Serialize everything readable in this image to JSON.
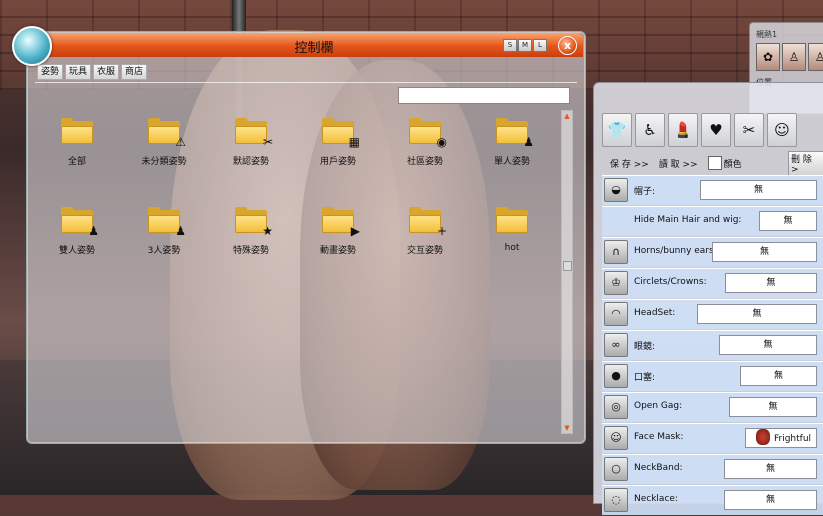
{
  "window": {
    "title": "控制欄",
    "size_buttons": [
      "S",
      "M",
      "L"
    ],
    "close_label": "x"
  },
  "menu": [
    "姿勢",
    "玩具",
    "衣服",
    "商店"
  ],
  "search": {
    "value": ""
  },
  "folders": [
    {
      "label": "全部",
      "icon": "multi-folder-icon",
      "badge": ""
    },
    {
      "label": "未分類姿勢",
      "icon": "warning-folder-icon",
      "badge": "⚠"
    },
    {
      "label": "默認姿勢",
      "icon": "pose-folder-icon",
      "badge": "✂"
    },
    {
      "label": "用戶姿勢",
      "icon": "user-folder-icon",
      "badge": "▦"
    },
    {
      "label": "社區姿勢",
      "icon": "community-folder-icon",
      "badge": "◉"
    },
    {
      "label": "單人姿勢",
      "icon": "single-folder-icon",
      "badge": "♟"
    },
    {
      "label": "雙人姿勢",
      "icon": "couple-folder-icon",
      "badge": "♟"
    },
    {
      "label": "3人姿勢",
      "icon": "group-folder-icon",
      "badge": "♟"
    },
    {
      "label": "特殊姿勢",
      "icon": "star-folder-icon",
      "badge": "★"
    },
    {
      "label": "動畫姿勢",
      "icon": "animation-folder-icon",
      "badge": "▶"
    },
    {
      "label": "交互姿勢",
      "icon": "interact-folder-icon",
      "badge": "+"
    },
    {
      "label": "hot",
      "icon": "folder-icon",
      "badge": ""
    }
  ],
  "mini_panel": {
    "label_top": "親熱1",
    "label_bottom": "位置"
  },
  "toolbar": {
    "save": "保 存 >>",
    "load": "讀 取 >>",
    "color": "顏色",
    "remove": "刪 除 >"
  },
  "outfit_rows": [
    {
      "label": "帽子:",
      "value": "無",
      "icon": "hat-icon",
      "glyph": "◒"
    },
    {
      "label": "Hide Main Hair and wig:",
      "value": "無",
      "icon": "",
      "glyph": ""
    },
    {
      "label": "Horns/bunny ears:",
      "value": "無",
      "icon": "horns-icon",
      "glyph": "∩"
    },
    {
      "label": "Circlets/Crowns:",
      "value": "無",
      "icon": "crown-icon",
      "glyph": "♔"
    },
    {
      "label": "HeadSet:",
      "value": "無",
      "icon": "headset-icon",
      "glyph": "◠"
    },
    {
      "label": "眼鏡:",
      "value": "無",
      "icon": "glasses-icon",
      "glyph": "∞"
    },
    {
      "label": "口塞:",
      "value": "無",
      "icon": "gag-icon",
      "glyph": "●"
    },
    {
      "label": "Open Gag:",
      "value": "無",
      "icon": "open-gag-icon",
      "glyph": "◎"
    },
    {
      "label": "Face Mask:",
      "value": "Frightful",
      "icon": "mask-icon",
      "glyph": "☺"
    },
    {
      "label": "NeckBand:",
      "value": "無",
      "icon": "neckband-icon",
      "glyph": "○"
    },
    {
      "label": "Necklace:",
      "value": "無",
      "icon": "necklace-icon",
      "glyph": "◌"
    }
  ]
}
